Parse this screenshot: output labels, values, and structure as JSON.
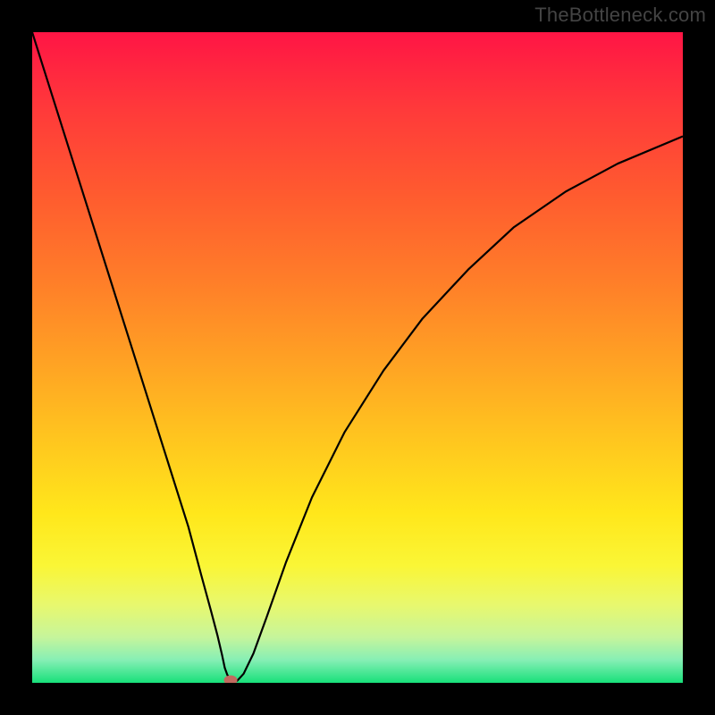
{
  "watermark": "TheBottleneck.com",
  "chart_data": {
    "type": "line",
    "title": "",
    "xlabel": "",
    "ylabel": "",
    "xlim": [
      0,
      100
    ],
    "ylim": [
      0,
      100
    ],
    "grid": false,
    "legend": false,
    "background_gradient": {
      "stops": [
        {
          "offset": 0.0,
          "color": "#ff1545"
        },
        {
          "offset": 0.12,
          "color": "#ff3a3a"
        },
        {
          "offset": 0.25,
          "color": "#ff5b2f"
        },
        {
          "offset": 0.38,
          "color": "#ff7d29"
        },
        {
          "offset": 0.5,
          "color": "#ffa024"
        },
        {
          "offset": 0.62,
          "color": "#ffc41f"
        },
        {
          "offset": 0.74,
          "color": "#ffe71b"
        },
        {
          "offset": 0.82,
          "color": "#faf636"
        },
        {
          "offset": 0.88,
          "color": "#e8f86e"
        },
        {
          "offset": 0.93,
          "color": "#c6f59b"
        },
        {
          "offset": 0.965,
          "color": "#86efb5"
        },
        {
          "offset": 1.0,
          "color": "#18e07a"
        }
      ]
    },
    "series": [
      {
        "name": "bottleneck-curve",
        "x": [
          0,
          3,
          6,
          9,
          12,
          15,
          18,
          21,
          24,
          26,
          27.5,
          28.5,
          29.2,
          29.6,
          30,
          30.4,
          30.8,
          31.5,
          32.5,
          34,
          36,
          39,
          43,
          48,
          54,
          60,
          67,
          74,
          82,
          90,
          100
        ],
        "y": [
          100,
          90.5,
          81,
          71.5,
          62,
          52.5,
          43,
          33.5,
          24,
          16.5,
          11,
          7.2,
          4.2,
          2.3,
          1.2,
          0.6,
          0.3,
          0.3,
          1.4,
          4.5,
          10,
          18.5,
          28.5,
          38.5,
          48,
          56,
          63.5,
          70,
          75.5,
          79.8,
          84
        ]
      }
    ],
    "marker": {
      "x": 30.5,
      "y": 0.4,
      "color": "#c26a5f"
    }
  }
}
